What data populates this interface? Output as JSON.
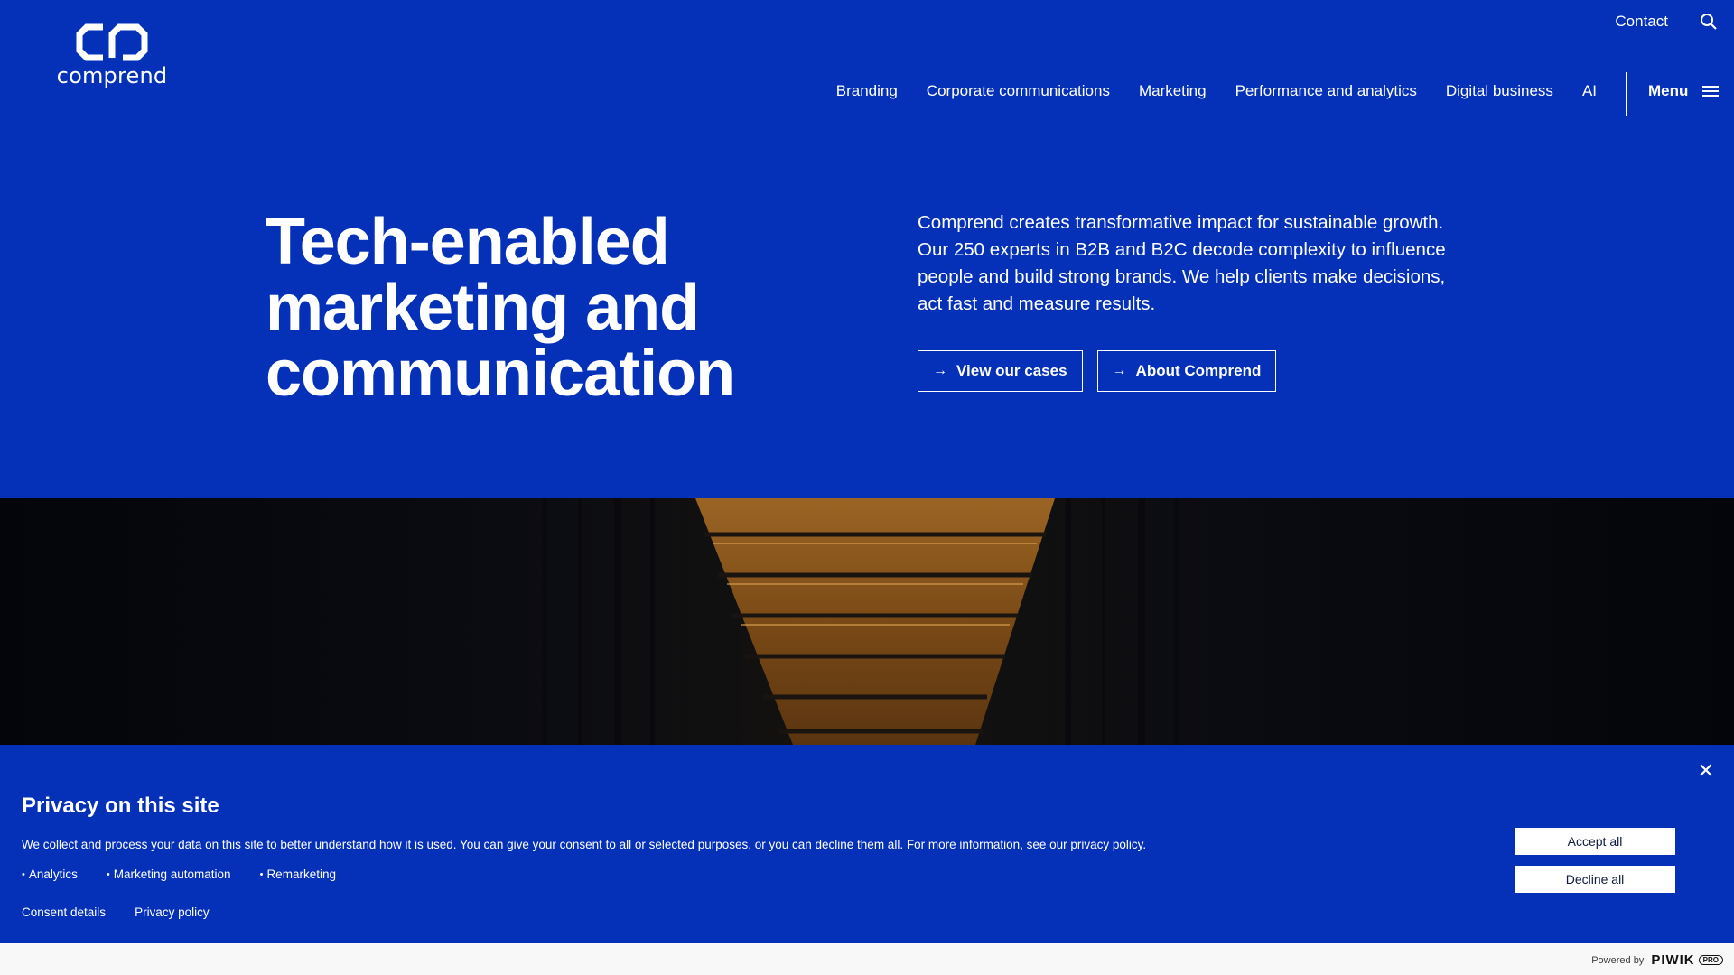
{
  "header": {
    "logo_text": "comprend",
    "contact_label": "Contact",
    "search_icon": "search-icon",
    "nav": [
      {
        "label": "Branding"
      },
      {
        "label": "Corporate communications"
      },
      {
        "label": "Marketing"
      },
      {
        "label": "Performance and analytics"
      },
      {
        "label": "Digital business"
      },
      {
        "label": "AI"
      }
    ],
    "menu_label": "Menu",
    "menu_icon": "hamburger-icon"
  },
  "hero": {
    "title_lines": [
      "Tech-enabled",
      "marketing and",
      "communication"
    ],
    "description": "Comprend creates transformative impact for sustainable growth. Our 250 experts in B2B and B2C decode complexity to influence people and build strong brands. We help clients make decisions, act fast and measure results.",
    "buttons": [
      {
        "label": "View our cases",
        "icon": "arrow-right-icon"
      },
      {
        "label": "About Comprend",
        "icon": "arrow-right-icon"
      }
    ]
  },
  "consent": {
    "close_icon": "close-icon",
    "title": "Privacy on this site",
    "text": "We collect and process your data on this site to better understand how it is used. You can give your consent to all or selected purposes, or you can decline them all. For more information, see our privacy policy.",
    "purposes": [
      "Analytics",
      "Marketing automation",
      "Remarketing"
    ],
    "links": [
      "Consent details",
      "Privacy policy"
    ],
    "accept_label": "Accept all",
    "decline_label": "Decline all",
    "powered_label": "Powered by",
    "brand_label": "PIWIK",
    "brand_badge": "PRO"
  },
  "colors": {
    "brand_blue": "#0531b9",
    "white": "#ffffff",
    "image_dark": "#03050b",
    "image_orange": "#c07a26"
  }
}
